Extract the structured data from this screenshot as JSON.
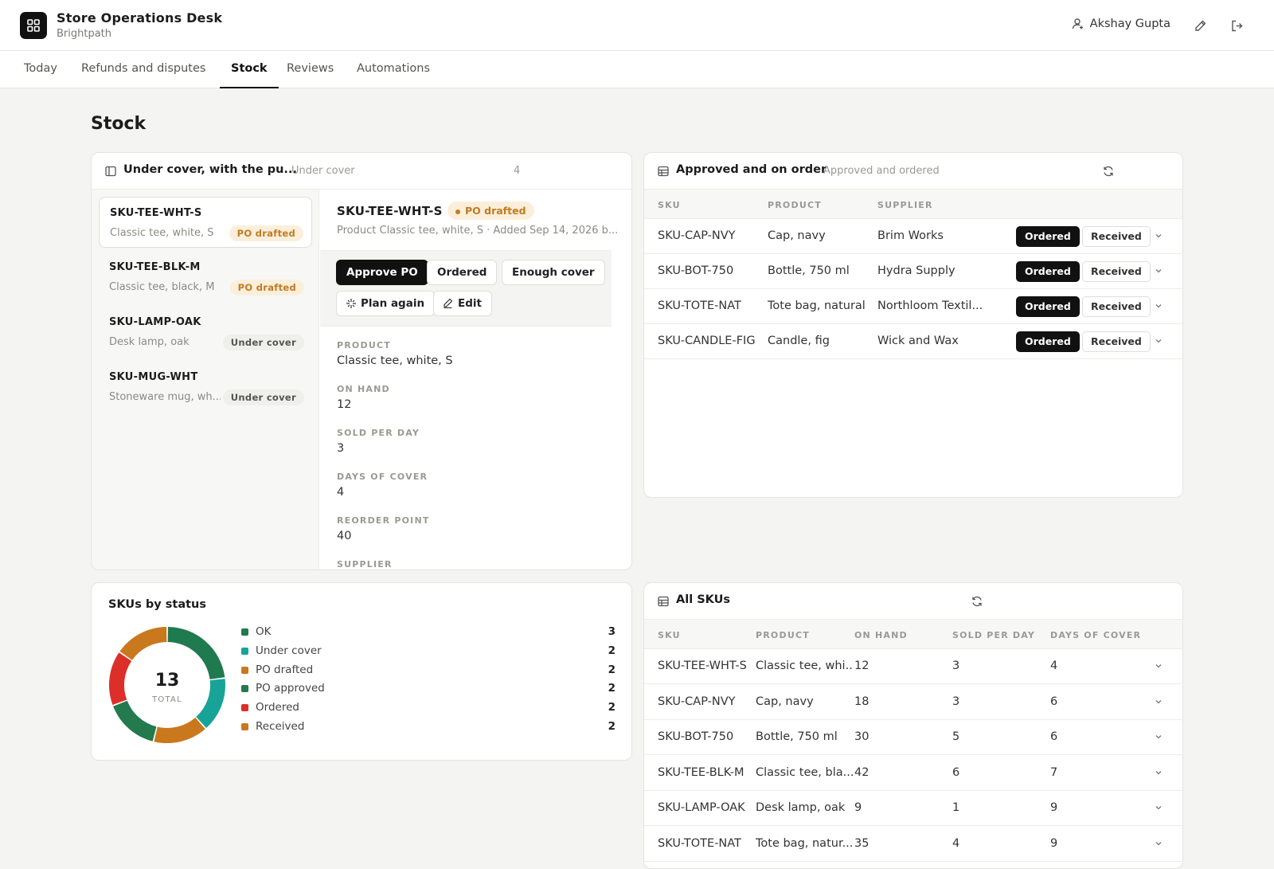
{
  "app": {
    "title": "Store Operations Desk",
    "org": "Brightpath",
    "user": "Akshay Gupta"
  },
  "tabs": [
    "Today",
    "Refunds and disputes",
    "Stock",
    "Reviews",
    "Automations"
  ],
  "active_tab": "Stock",
  "page_title": "Stock",
  "colors": {
    "ok": "#1f7a4f",
    "under_cover": "#17a398",
    "po_drafted": "#c9781d",
    "po_approved": "#227a4d",
    "ordered": "#dc2f2a",
    "received": "#c9781d",
    "badge_orange": "#c37a1e"
  },
  "under_cover_card": {
    "title": "Under cover, with the pu...",
    "subtitle": "Under cover",
    "count": "4",
    "items": [
      {
        "sku": "SKU-TEE-WHT-S",
        "desc": "Classic tee, white, S",
        "status": "PO drafted",
        "tone": "orange"
      },
      {
        "sku": "SKU-TEE-BLK-M",
        "desc": "Classic tee, black, M",
        "status": "PO drafted",
        "tone": "orange"
      },
      {
        "sku": "SKU-LAMP-OAK",
        "desc": "Desk lamp, oak",
        "status": "Under cover",
        "tone": "gray"
      },
      {
        "sku": "SKU-MUG-WHT",
        "desc": "Stoneware mug, wh...",
        "status": "Under cover",
        "tone": "gray"
      }
    ],
    "detail": {
      "sku": "SKU-TEE-WHT-S",
      "status": "PO drafted",
      "meta": "Product Classic tee, white, S  ·  Added Sep 14, 2026 b...",
      "buttons": {
        "approve": "Approve PO",
        "ordered": "Ordered",
        "enough": "Enough cover",
        "plan": "Plan again",
        "edit": "Edit"
      },
      "fields": [
        {
          "label": "PRODUCT",
          "value": "Classic tee, white, S"
        },
        {
          "label": "ON HAND",
          "value": "12"
        },
        {
          "label": "SOLD PER DAY",
          "value": "3"
        },
        {
          "label": "DAYS OF COVER",
          "value": "4"
        },
        {
          "label": "REORDER POINT",
          "value": "40"
        },
        {
          "label": "SUPPLIER",
          "value": ""
        }
      ]
    }
  },
  "order_card": {
    "title": "Approved and on order",
    "subtitle": "Approved and ordered",
    "columns": [
      "SKU",
      "PRODUCT",
      "SUPPLIER"
    ],
    "ordered_label": "Ordered",
    "received_label": "Received",
    "rows": [
      {
        "sku": "SKU-CAP-NVY",
        "product": "Cap, navy",
        "supplier": "Brim Works"
      },
      {
        "sku": "SKU-BOT-750",
        "product": "Bottle, 750 ml",
        "supplier": "Hydra Supply"
      },
      {
        "sku": "SKU-TOTE-NAT",
        "product": "Tote bag, natural",
        "supplier": "Northloom Textil..."
      },
      {
        "sku": "SKU-CANDLE-FIG",
        "product": "Candle, fig",
        "supplier": "Wick and Wax"
      }
    ]
  },
  "status_card": {
    "title": "SKUs by status",
    "total": "13",
    "total_label": "TOTAL"
  },
  "chart_data": {
    "type": "pie",
    "title": "SKUs by status",
    "categories": [
      "OK",
      "Under cover",
      "PO drafted",
      "PO approved",
      "Ordered",
      "Received"
    ],
    "values": [
      3,
      2,
      2,
      2,
      2,
      2
    ],
    "colors": [
      "#1f7a4f",
      "#17a398",
      "#c9781d",
      "#227a4d",
      "#dc2f2a",
      "#c9781d"
    ],
    "legend": "right"
  },
  "all_skus_card": {
    "title": "All SKUs",
    "columns": [
      "SKU",
      "PRODUCT",
      "ON HAND",
      "SOLD PER DAY",
      "DAYS OF COVER"
    ],
    "rows": [
      {
        "sku": "SKU-TEE-WHT-S",
        "product": "Classic tee, whi...",
        "on_hand": "12",
        "sold": "3",
        "days": "4"
      },
      {
        "sku": "SKU-CAP-NVY",
        "product": "Cap, navy",
        "on_hand": "18",
        "sold": "3",
        "days": "6"
      },
      {
        "sku": "SKU-BOT-750",
        "product": "Bottle, 750 ml",
        "on_hand": "30",
        "sold": "5",
        "days": "6"
      },
      {
        "sku": "SKU-TEE-BLK-M",
        "product": "Classic tee, bla...",
        "on_hand": "42",
        "sold": "6",
        "days": "7"
      },
      {
        "sku": "SKU-LAMP-OAK",
        "product": "Desk lamp, oak",
        "on_hand": "9",
        "sold": "1",
        "days": "9"
      },
      {
        "sku": "SKU-TOTE-NAT",
        "product": "Tote bag, natur...",
        "on_hand": "35",
        "sold": "4",
        "days": "9"
      }
    ]
  }
}
